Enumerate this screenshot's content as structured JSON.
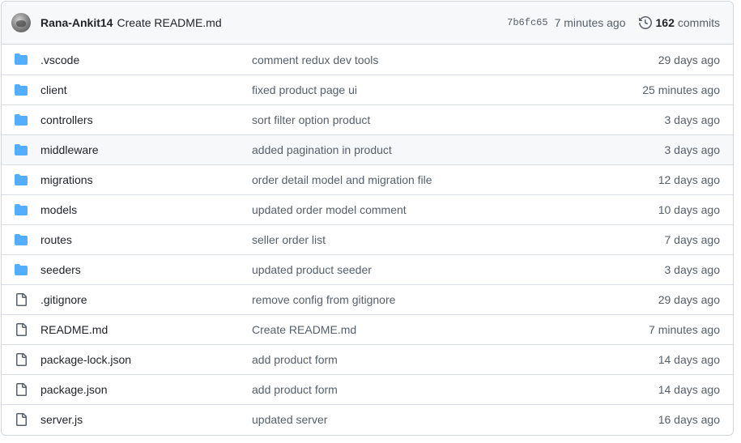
{
  "latest_commit": {
    "author": "Rana-Ankit14",
    "message": "Create README.md",
    "sha": "7b6fc65",
    "time": "7 minutes ago",
    "commit_count": "162",
    "commit_word": "commits"
  },
  "colors": {
    "folder": "#54aeff",
    "file": "#57606a",
    "muted": "#57606a",
    "border": "#d0d7de"
  },
  "files": [
    {
      "type": "folder",
      "icon": "folder-icon",
      "name": ".vscode",
      "message": "comment redux dev tools",
      "age": "29 days ago"
    },
    {
      "type": "folder",
      "icon": "folder-icon",
      "name": "client",
      "message": "fixed product page ui",
      "age": "25 minutes ago"
    },
    {
      "type": "folder",
      "icon": "folder-icon",
      "name": "controllers",
      "message": "sort filter option product",
      "age": "3 days ago"
    },
    {
      "type": "folder",
      "icon": "folder-icon",
      "name": "middleware",
      "message": "added pagination in product",
      "age": "3 days ago"
    },
    {
      "type": "folder",
      "icon": "folder-icon",
      "name": "migrations",
      "message": "order detail model and migration file",
      "age": "12 days ago"
    },
    {
      "type": "folder",
      "icon": "folder-icon",
      "name": "models",
      "message": "updated order model comment",
      "age": "10 days ago"
    },
    {
      "type": "folder",
      "icon": "folder-icon",
      "name": "routes",
      "message": "seller order list",
      "age": "7 days ago"
    },
    {
      "type": "folder",
      "icon": "folder-icon",
      "name": "seeders",
      "message": "updated product seeder",
      "age": "3 days ago"
    },
    {
      "type": "file",
      "icon": "file-icon",
      "name": ".gitignore",
      "message": "remove config from gitignore",
      "age": "29 days ago"
    },
    {
      "type": "file",
      "icon": "file-icon",
      "name": "README.md",
      "message": "Create README.md",
      "age": "7 minutes ago"
    },
    {
      "type": "file",
      "icon": "file-icon",
      "name": "package-lock.json",
      "message": "add product form",
      "age": "14 days ago"
    },
    {
      "type": "file",
      "icon": "file-icon",
      "name": "package.json",
      "message": "add product form",
      "age": "14 days ago"
    },
    {
      "type": "file",
      "icon": "file-icon",
      "name": "server.js",
      "message": "updated server",
      "age": "16 days ago"
    }
  ]
}
